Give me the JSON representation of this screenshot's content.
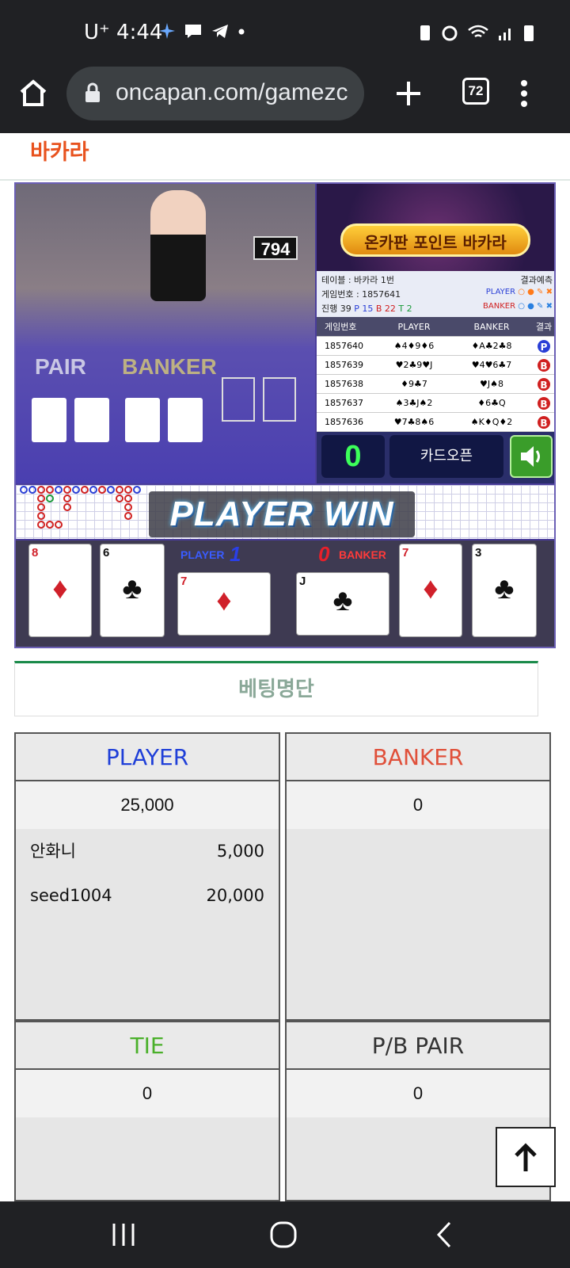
{
  "status": {
    "time": "4:44",
    "carrier": "U⁺"
  },
  "browser": {
    "url": "oncapan.com/gamezc",
    "tab_count": "72"
  },
  "site": {
    "title": "바카라"
  },
  "video": {
    "table_no": "794",
    "pair_label": "PAIR",
    "banker_label": "BANKER"
  },
  "panel": {
    "banner": "온카판 포인트 바카라",
    "table": "테이블 : 바카라 1번",
    "prediction": "결과예측",
    "game_no": "게임번호 : 1857641",
    "progress": "진행 39",
    "p_count": "P 15",
    "b_count": "B 22",
    "t_count": "T 2",
    "player": "PLAYER",
    "banker": "BANKER",
    "headers": [
      "게임번호",
      "PLAYER",
      "BANKER",
      "결과"
    ],
    "rows": [
      {
        "no": "1857640",
        "player": "♠4♦9♦6",
        "banker": "♦A♣2♣8",
        "result": "P",
        "color": "#2a3fd6"
      },
      {
        "no": "1857639",
        "player": "♥2♣9♥J",
        "banker": "♥4♥6♣7",
        "result": "B",
        "color": "#d02020"
      },
      {
        "no": "1857638",
        "player": "♦9♣7",
        "banker": "♥J♠8",
        "result": "B",
        "color": "#d02020"
      },
      {
        "no": "1857637",
        "player": "♠3♣J♠2",
        "banker": "♦6♣Q",
        "result": "B",
        "color": "#d02020"
      },
      {
        "no": "1857636",
        "player": "♥7♣8♠6",
        "banker": "♠K♦Q♦2",
        "result": "B",
        "color": "#d02020"
      }
    ],
    "counter": "0",
    "card_open": "카드오픈"
  },
  "result": {
    "banner": "PLAYER WIN",
    "player_label": "PLAYER",
    "player_score": "1",
    "banker_score": "0",
    "banker_label": "BANKER"
  },
  "dealt": {
    "player": [
      {
        "rank": "8",
        "suit": "♦"
      },
      {
        "rank": "6",
        "suit": "♣"
      },
      {
        "rank": "7",
        "suit": "♦"
      }
    ],
    "banker": [
      {
        "rank": "J",
        "suit": "♣"
      },
      {
        "rank": "7",
        "suit": "♦"
      },
      {
        "rank": "3",
        "suit": "♣"
      }
    ]
  },
  "betlist": {
    "title": "베팅명단"
  },
  "bets": {
    "player": {
      "label": "PLAYER",
      "total": "25,000",
      "entries": [
        {
          "name": "안화니",
          "amount": "5,000"
        },
        {
          "name": "seed1004",
          "amount": "20,000"
        }
      ]
    },
    "banker": {
      "label": "BANKER",
      "total": "0"
    },
    "tie": {
      "label": "TIE",
      "total": "0"
    },
    "pair": {
      "label": "P/B PAIR",
      "total": "0"
    }
  },
  "colors": {
    "player": "#1f3fd8",
    "banker": "#e0503a",
    "tie": "#4ab02a",
    "pair": "#333333"
  }
}
